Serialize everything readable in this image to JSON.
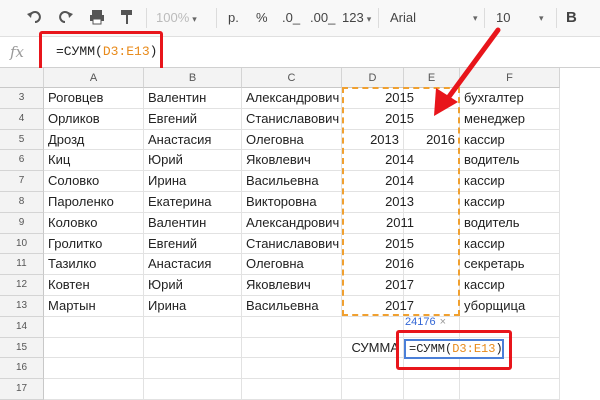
{
  "toolbar": {
    "zoom": "100%",
    "currency": "р.",
    "percent": "%",
    "dec_less": ".0_",
    "dec_more": ".00_",
    "format": "123",
    "font": "Arial",
    "size": "10",
    "bold": "B"
  },
  "formula_bar": {
    "fx": "fx",
    "prefix": "=СУММ(",
    "range": "D3:E13",
    "suffix": ")"
  },
  "columns": [
    "A",
    "B",
    "C",
    "D",
    "E",
    "F"
  ],
  "rows": [
    {
      "n": "3",
      "a": "Роговцев",
      "b": "Валентин",
      "c": "Александрович",
      "d": "",
      "de": "2015",
      "e": "",
      "f": "бухгалтер"
    },
    {
      "n": "4",
      "a": "Орликов",
      "b": "Евгений",
      "c": "Станиславович",
      "d": "",
      "de": "2015",
      "e": "",
      "f": "менеджер"
    },
    {
      "n": "5",
      "a": "Дрозд",
      "b": "Анастасия",
      "c": "Олеговна",
      "d": "2013",
      "de": "",
      "e": "2016",
      "f": "кассир"
    },
    {
      "n": "6",
      "a": "Киц",
      "b": "Юрий",
      "c": "Яковлевич",
      "d": "",
      "de": "2014",
      "e": "",
      "f": "водитель"
    },
    {
      "n": "7",
      "a": "Соловко",
      "b": "Ирина",
      "c": "Васильевна",
      "d": "",
      "de": "2014",
      "e": "",
      "f": "кассир"
    },
    {
      "n": "8",
      "a": "Пароленко",
      "b": "Екатерина",
      "c": "Викторовна",
      "d": "",
      "de": "2013",
      "e": "",
      "f": "кассир"
    },
    {
      "n": "9",
      "a": "Коловко",
      "b": "Валентин",
      "c": "Александрович",
      "d": "",
      "de": "2011",
      "e": "",
      "f": "водитель"
    },
    {
      "n": "10",
      "a": "Гролитко",
      "b": "Евгений",
      "c": "Станиславович",
      "d": "",
      "de": "2015",
      "e": "",
      "f": "кассир"
    },
    {
      "n": "11",
      "a": "Тазилко",
      "b": "Анастасия",
      "c": "Олеговна",
      "d": "",
      "de": "2016",
      "e": "",
      "f": "секретарь"
    },
    {
      "n": "12",
      "a": "Ковтен",
      "b": "Юрий",
      "c": "Яковлевич",
      "d": "",
      "de": "2017",
      "e": "",
      "f": "кассир"
    },
    {
      "n": "13",
      "a": "Мартын",
      "b": "Ирина",
      "c": "Васильевна",
      "d": "",
      "de": "2017",
      "e": "",
      "f": "уборщица"
    },
    {
      "n": "14",
      "a": "",
      "b": "",
      "c": "",
      "d": "",
      "de": "",
      "e": "",
      "f": ""
    },
    {
      "n": "15",
      "a": "",
      "b": "",
      "c": "",
      "d": "СУММА",
      "de": "",
      "e": "",
      "f": ""
    },
    {
      "n": "16",
      "a": "",
      "b": "",
      "c": "",
      "d": "",
      "de": "",
      "e": "",
      "f": ""
    },
    {
      "n": "17",
      "a": "",
      "b": "",
      "c": "",
      "d": "",
      "de": "",
      "e": "",
      "f": ""
    }
  ],
  "tooltip": {
    "value": "24176",
    "close": "×"
  },
  "edit_cell": {
    "prefix": "=СУММ(",
    "range": "D3:E13",
    "suffix": ")"
  },
  "colors": {
    "highlight": "#e8151b",
    "range": "#e88a1a",
    "selection": "#4a7fd8"
  }
}
